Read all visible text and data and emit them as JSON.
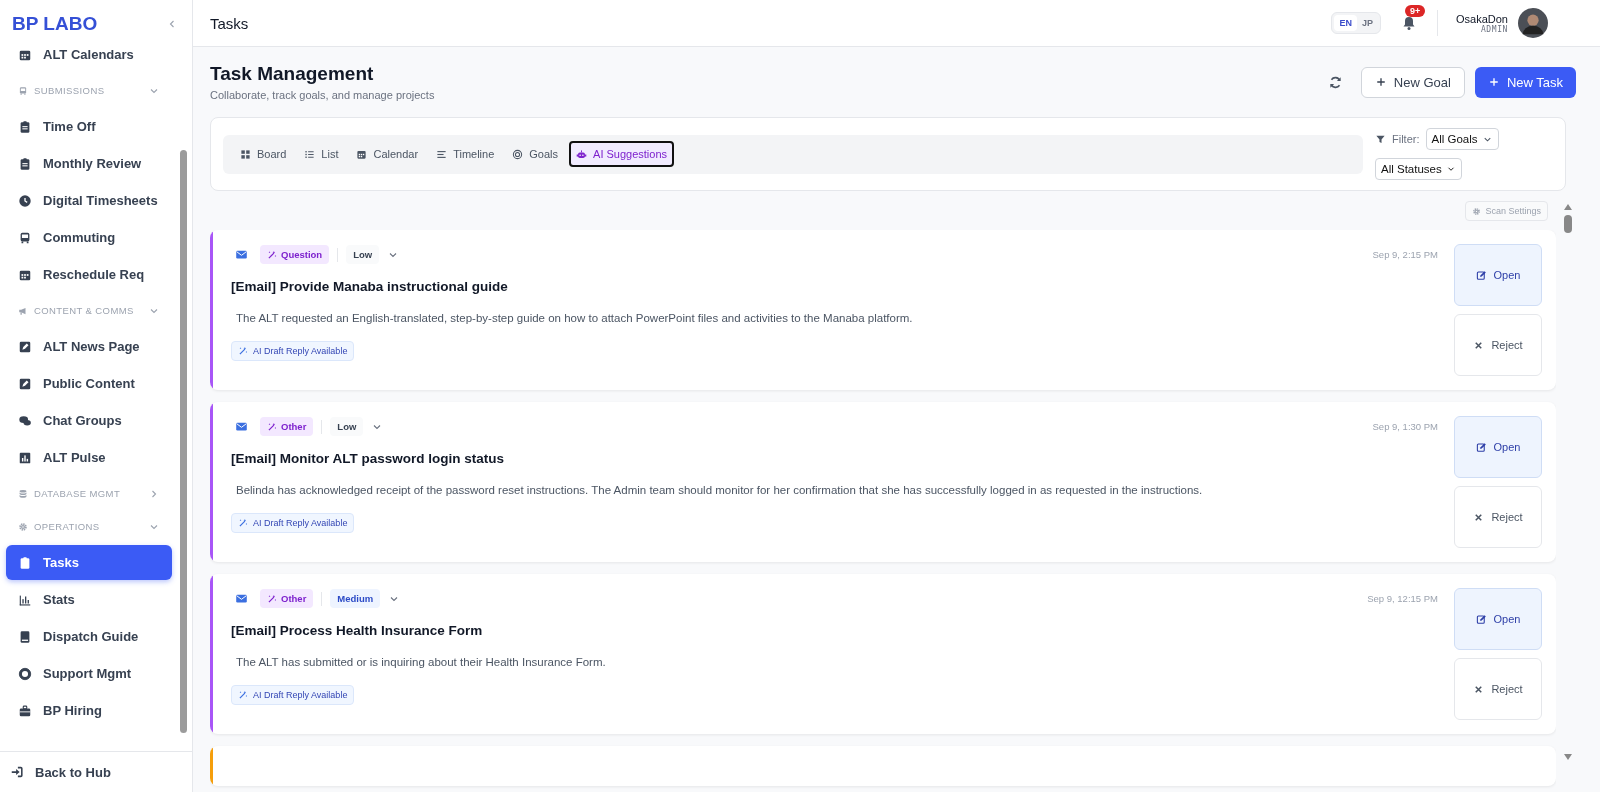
{
  "sidebar": {
    "logo": "BP LABO",
    "items": [
      {
        "kind": "link",
        "label": "ALT Calendars",
        "selected": false
      },
      {
        "kind": "section",
        "label": "SUBMISSIONS",
        "expanded": true,
        "children": [
          {
            "kind": "link",
            "label": "Time Off",
            "selected": false
          },
          {
            "kind": "link",
            "label": "Monthly Review",
            "selected": false
          },
          {
            "kind": "link",
            "label": "Digital Timesheets",
            "selected": false
          },
          {
            "kind": "link",
            "label": "Commuting",
            "selected": false
          },
          {
            "kind": "link",
            "label": "Reschedule Req",
            "selected": false
          }
        ]
      },
      {
        "kind": "section",
        "label": "CONTENT & COMMS",
        "expanded": true,
        "children": [
          {
            "kind": "link",
            "label": "ALT News Page",
            "selected": false
          },
          {
            "kind": "link",
            "label": "Public Content",
            "selected": false
          },
          {
            "kind": "link",
            "label": "Chat Groups",
            "selected": false
          },
          {
            "kind": "link",
            "label": "ALT Pulse",
            "selected": false
          }
        ]
      },
      {
        "kind": "section",
        "label": "DATABASE MGMT",
        "expanded": false
      },
      {
        "kind": "section",
        "label": "OPERATIONS",
        "expanded": true,
        "children": [
          {
            "kind": "link",
            "label": "Tasks",
            "selected": true
          },
          {
            "kind": "link",
            "label": "Stats",
            "selected": false
          },
          {
            "kind": "link",
            "label": "Dispatch Guide",
            "selected": false
          },
          {
            "kind": "link",
            "label": "Support Mgmt",
            "selected": false
          },
          {
            "kind": "link",
            "label": "BP Hiring",
            "selected": false
          }
        ]
      }
    ],
    "footer": "Back to Hub"
  },
  "header": {
    "title": "Tasks",
    "languages": [
      {
        "label": "EN",
        "selected": true
      },
      {
        "label": "JP",
        "selected": false
      }
    ],
    "notification_count": "9+",
    "user": {
      "name": "OsakaDon",
      "role": "ADMIN"
    }
  },
  "page": {
    "title": "Task Management",
    "subtitle": "Collaborate, track goals, and manage projects",
    "actions": [
      {
        "kind": "secondary",
        "label": "New Goal"
      },
      {
        "kind": "primary",
        "label": "New Task"
      }
    ],
    "views": [
      {
        "label": "Board",
        "selected": false
      },
      {
        "label": "List",
        "selected": false
      },
      {
        "label": "Calendar",
        "selected": false
      },
      {
        "label": "Timeline",
        "selected": false
      },
      {
        "label": "Goals",
        "selected": false
      },
      {
        "label": "AI Suggestions",
        "selected": true
      }
    ],
    "filter": {
      "label": "Filter:",
      "selects": [
        "All Goals",
        "All Statuses"
      ]
    },
    "scan_settings": "Scan Settings"
  },
  "suggestions": [
    {
      "color": "#a855f7",
      "category": "Question",
      "priority": {
        "label": "Low",
        "kind": "low"
      },
      "time": "Sep 9, 2:15 PM",
      "title": "[Email] Provide Manaba instructional guide",
      "description": "The ALT requested an English-translated, step-by-step guide on how to attach PowerPoint files and activities to the Manaba platform.",
      "draft": "AI Draft Reply Available",
      "open": "Open",
      "reject": "Reject"
    },
    {
      "color": "#a855f7",
      "category": "Other",
      "priority": {
        "label": "Low",
        "kind": "low"
      },
      "time": "Sep 9, 1:30 PM",
      "title": "[Email] Monitor ALT password login status",
      "description": "Belinda has acknowledged receipt of the password reset instructions. The Admin team should monitor for her confirmation that she has successfully logged in as requested in the instructions.",
      "draft": "AI Draft Reply Available",
      "open": "Open",
      "reject": "Reject"
    },
    {
      "color": "#a855f7",
      "category": "Other",
      "priority": {
        "label": "Medium",
        "kind": "medium"
      },
      "time": "Sep 9, 12:15 PM",
      "title": "[Email] Process Health Insurance Form",
      "description": "The ALT has submitted or is inquiring about their Health Insurance Form.",
      "draft": "AI Draft Reply Available",
      "open": "Open",
      "reject": "Reject"
    },
    {
      "color": "#f59e0b"
    }
  ]
}
